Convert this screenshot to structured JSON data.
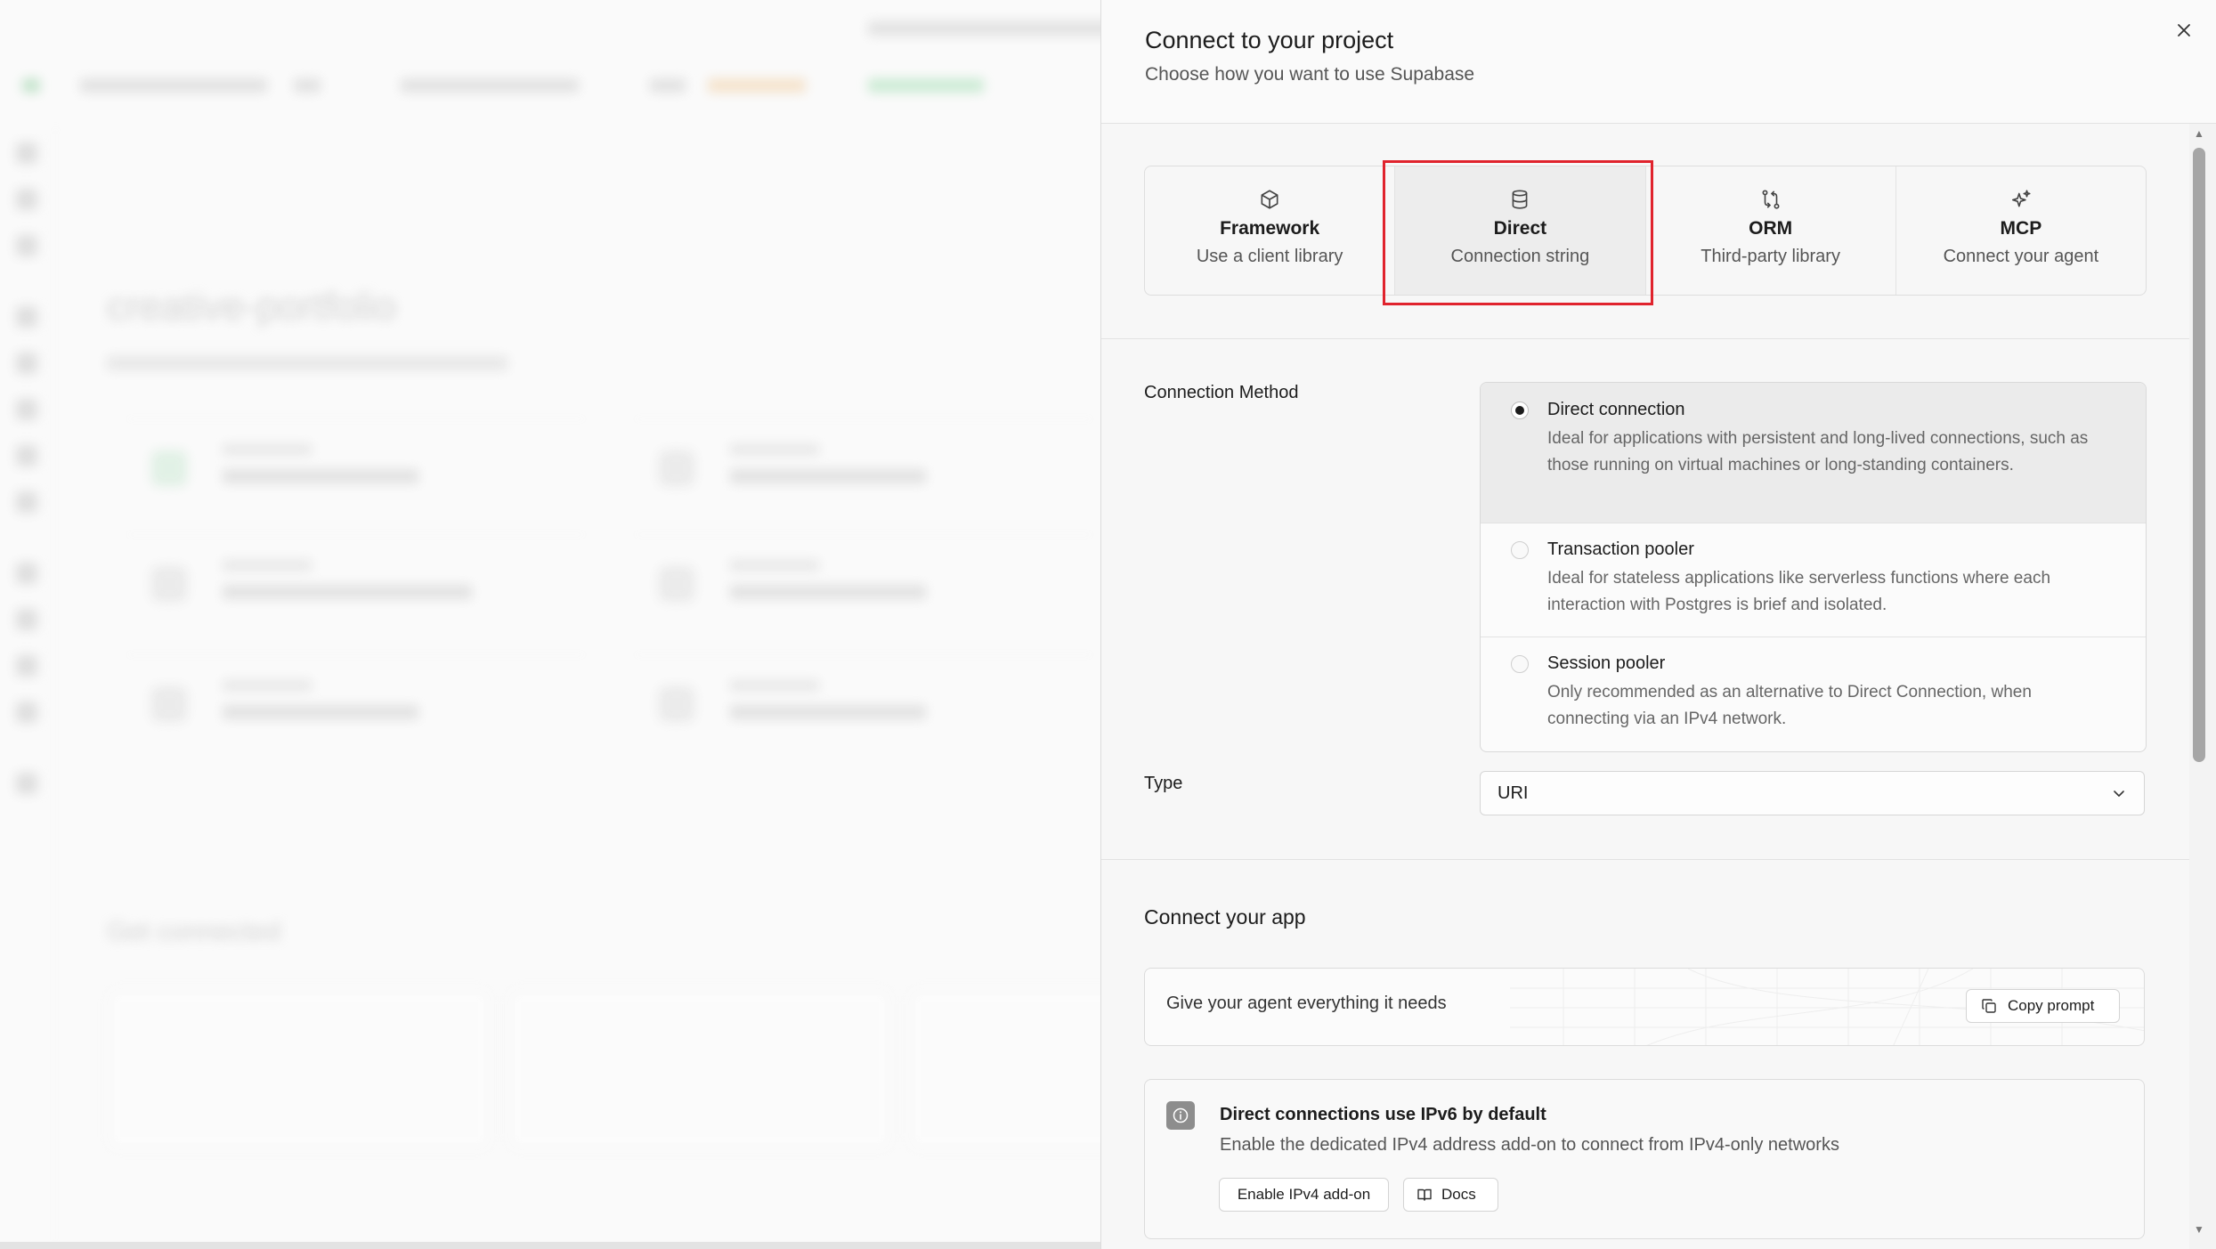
{
  "background_app": {
    "page_title": "creative-portfolio",
    "section_title": "Get connected"
  },
  "panel": {
    "title": "Connect to your project",
    "subtitle": "Choose how you want to use Supabase",
    "close_icon": "close-icon"
  },
  "tabs": [
    {
      "name": "Framework",
      "desc": "Use a client library",
      "icon": "cube-icon",
      "active": false
    },
    {
      "name": "Direct",
      "desc": "Connection string",
      "icon": "database-icon",
      "active": true
    },
    {
      "name": "ORM",
      "desc": "Third-party library",
      "icon": "orm-icon",
      "active": false
    },
    {
      "name": "MCP",
      "desc": "Connect your agent",
      "icon": "sparkle-icon",
      "active": false
    }
  ],
  "connection_method": {
    "label": "Connection Method",
    "options": [
      {
        "title": "Direct connection",
        "desc": "Ideal for applications with persistent and long-lived connections, such as those running on virtual machines or long-standing containers.",
        "selected": true
      },
      {
        "title": "Transaction pooler",
        "desc": "Ideal for stateless applications like serverless functions where each interaction with Postgres is brief and isolated.",
        "selected": false
      },
      {
        "title": "Session pooler",
        "desc": "Only recommended as an alternative to Direct Connection, when connecting via an IPv4 network.",
        "selected": false
      }
    ]
  },
  "type": {
    "label": "Type",
    "value": "URI"
  },
  "connect_app": {
    "title": "Connect your app",
    "agent_text": "Give your agent everything it needs",
    "copy_prompt_label": "Copy prompt"
  },
  "notice": {
    "title": "Direct connections use IPv6 by default",
    "desc": "Enable the dedicated IPv4 address add-on to connect from IPv4-only networks",
    "enable_button": "Enable IPv4 add-on",
    "docs_button": "Docs"
  },
  "colors": {
    "highlight": "#e0232d",
    "accent_selected": "#1c1c1c"
  }
}
